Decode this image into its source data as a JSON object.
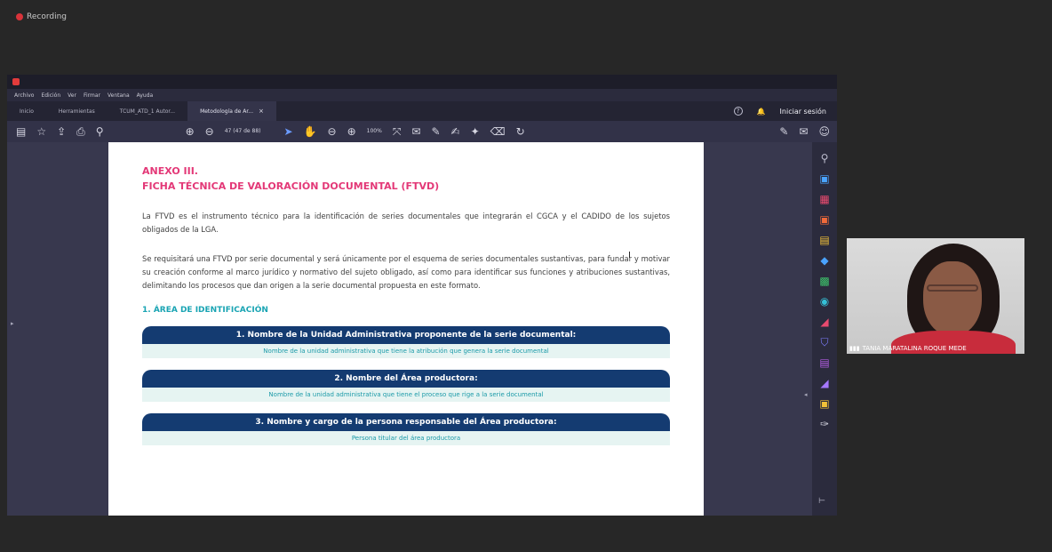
{
  "recording": {
    "label": "Recording"
  },
  "menu": [
    "Archivo",
    "Edición",
    "Ver",
    "Firmar",
    "Ventana",
    "Ayuda"
  ],
  "tabs": [
    {
      "label": "Inicio",
      "active": false
    },
    {
      "label": "Herramientas",
      "active": false
    },
    {
      "label": "TCUM_ATD_1 Autor...",
      "active": false
    },
    {
      "label": "Metodología de Ar...",
      "active": true
    }
  ],
  "tab_close_glyph": "×",
  "header": {
    "signin_label": "Iniciar sesión"
  },
  "toolbar": {
    "page_indicator": "47 (47 de 88)",
    "zoom": "100%"
  },
  "document": {
    "heading_line1": "ANEXO III.",
    "heading_line2": "FICHA TÉCNICA DE VALORACIÓN DOCUMENTAL (FTVD)",
    "paragraph1": "La FTVD es el instrumento técnico para la identificación de series documentales que integrarán el CGCA y el CADIDO de los sujetos obligados de la LGA.",
    "paragraph2": "Se requisitará una FTVD por serie documental y será únicamente por el esquema de series documentales sustantivas, para fundar y motivar su creación conforme al marco jurídico y normativo del sujeto obligado, así como para identificar sus funciones y atribuciones sustantivas, delimitando los procesos que dan origen a la serie documental propuesta en este formato.",
    "section_title": "1. ÁREA DE IDENTIFICACIÓN",
    "fields": [
      {
        "label": "1. Nombre de la Unidad Administrativa proponente de la serie documental:",
        "value": "Nombre de la unidad administrativa que tiene la atribución que genera la serie documental"
      },
      {
        "label": "2. Nombre del Área productora:",
        "value": "Nombre de la unidad administrativa que tiene el proceso que rige a la serie documental"
      },
      {
        "label": "3. Nombre y cargo de la persona responsable del Área productora:",
        "value": "Persona titular del área productora"
      }
    ]
  },
  "video": {
    "participant_name": "TANIA MARATALINA ROQUE MEDE"
  },
  "colors": {
    "heading_pink": "#e33877",
    "section_teal": "#19a4b3",
    "label_navy": "#143b71",
    "value_bg": "#e6f4f2",
    "tool_active": "#6a9bff"
  },
  "icons": {
    "toolbar": [
      "sidebar-toggle-icon",
      "star-icon",
      "upload-icon",
      "print-icon",
      "search-icon",
      "page-up-icon",
      "page-down-icon",
      "select-cursor-icon",
      "hand-icon",
      "zoom-out-icon",
      "zoom-in-icon",
      "fit-page-icon",
      "comment-icon",
      "highlight-icon",
      "sign-icon",
      "stamp-icon",
      "delete-icon",
      "rotate-icon"
    ],
    "sidebar": [
      "search-icon",
      "export-pdf-icon",
      "organize-pages-icon",
      "edit-pdf-icon",
      "comment-icon",
      "combine-icon",
      "compress-icon",
      "protect-icon",
      "redact-icon",
      "shield-icon",
      "form-icon",
      "sign-icon",
      "send-icon",
      "more-tools-icon"
    ]
  }
}
